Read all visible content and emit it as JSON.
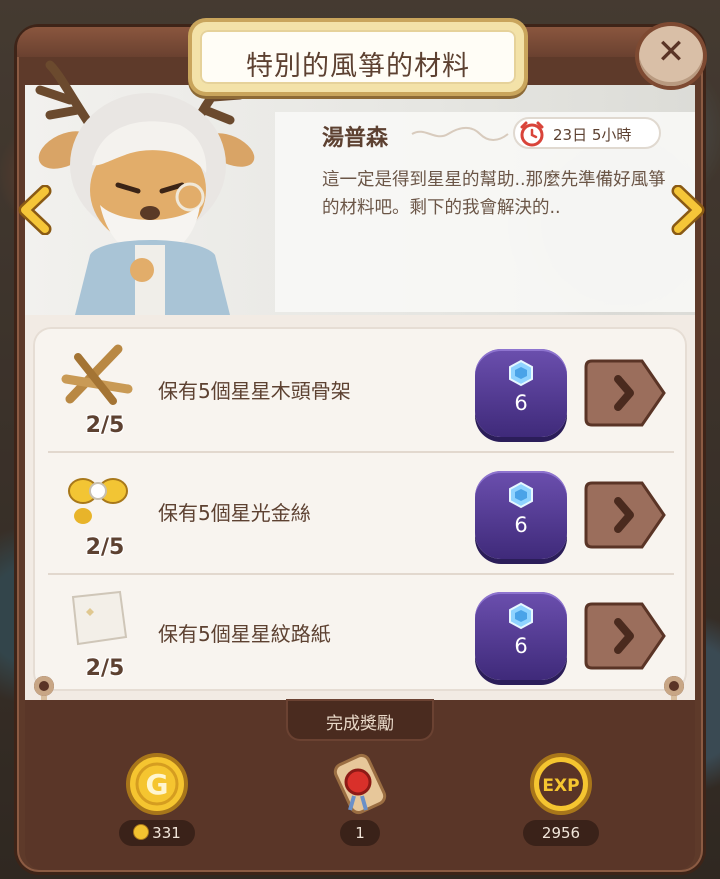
{
  "title": "特別的風箏的材料",
  "close_symbol": "✕",
  "npc": {
    "name": "湯普森",
    "timer": "23日 5小時",
    "dialog": "這一定是得到星星的幫助..那麼先準備好風箏的材料吧。剩下的我會解決的.."
  },
  "nav": {
    "prev_icon": "chevron-left-icon",
    "next_icon": "chevron-right-icon"
  },
  "quests": [
    {
      "text": "保有5個星星木頭骨架",
      "progress": "2/5",
      "gem_cost": "6",
      "icon": "wood-sticks-icon"
    },
    {
      "text": "保有5個星光金絲",
      "progress": "2/5",
      "gem_cost": "6",
      "icon": "gold-thread-icon"
    },
    {
      "text": "保有5個星星紋路紙",
      "progress": "2/5",
      "gem_cost": "6",
      "icon": "paper-icon"
    }
  ],
  "rewards": {
    "label": "完成獎勵",
    "coin": {
      "icon": "gold-coin-icon",
      "value": "331"
    },
    "item": {
      "icon": "scroll-icon",
      "value": "1"
    },
    "exp": {
      "icon": "exp-icon",
      "value": "2956"
    }
  },
  "colors": {
    "gem_button": "#4f3791",
    "frame": "#5e3a2a",
    "title_gold": "#c9a55c",
    "text_brown": "#5d4131"
  }
}
